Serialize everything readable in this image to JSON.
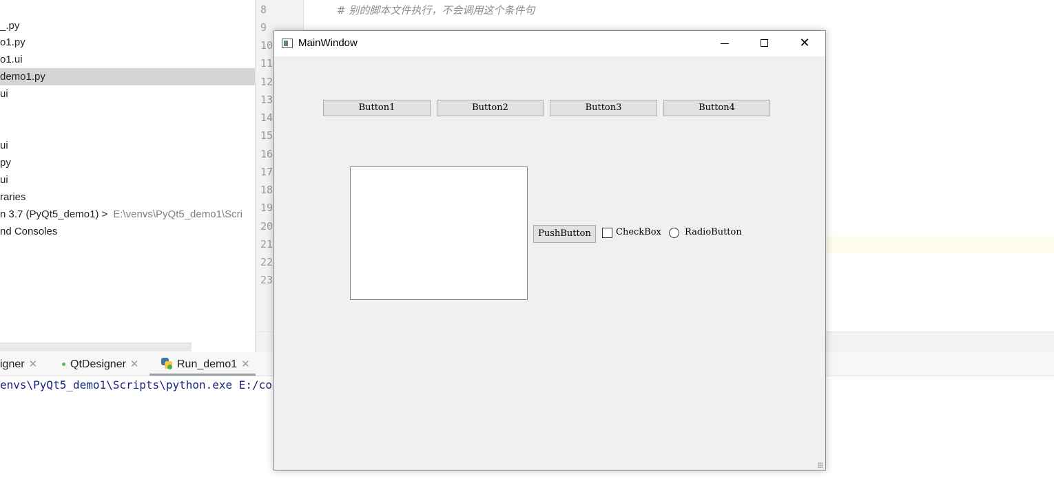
{
  "project_tree": {
    "items": [
      {
        "label": "_.py"
      },
      {
        "label": "o1.py"
      },
      {
        "label": "o1.ui"
      },
      {
        "label": "demo1.py"
      },
      {
        "label": "ui"
      },
      {
        "label": "ui"
      },
      {
        "label": "py"
      },
      {
        "label": "ui"
      },
      {
        "label": "raries"
      },
      {
        "label": "n 3.7 (PyQt5_demo1) >",
        "path": "E:\\venvs\\PyQt5_demo1\\Scri"
      },
      {
        "label": "nd Consoles"
      }
    ]
  },
  "editor": {
    "line_numbers": [
      "8",
      "9",
      "10",
      "11",
      "12",
      "13",
      "14",
      "15",
      "16",
      "17",
      "18",
      "19",
      "20",
      "21",
      "22",
      "23"
    ],
    "comment": "#  别的脚本文件执行，不会调用这个条件句"
  },
  "bottom_tabs": [
    {
      "label": "igner"
    },
    {
      "label": "QtDesigner"
    },
    {
      "label": "Run_demo1"
    }
  ],
  "console": {
    "line": "envs\\PyQt5_demo1\\Scripts\\python.exe E:/co"
  },
  "qt_window": {
    "title": "MainWindow",
    "buttons": [
      "Button1",
      "Button2",
      "Button3",
      "Button4"
    ],
    "push_button": "PushButton",
    "checkbox_label": "CheckBox",
    "checkbox_checked": false,
    "radio_label": "RadioButton",
    "radio_selected": false
  }
}
